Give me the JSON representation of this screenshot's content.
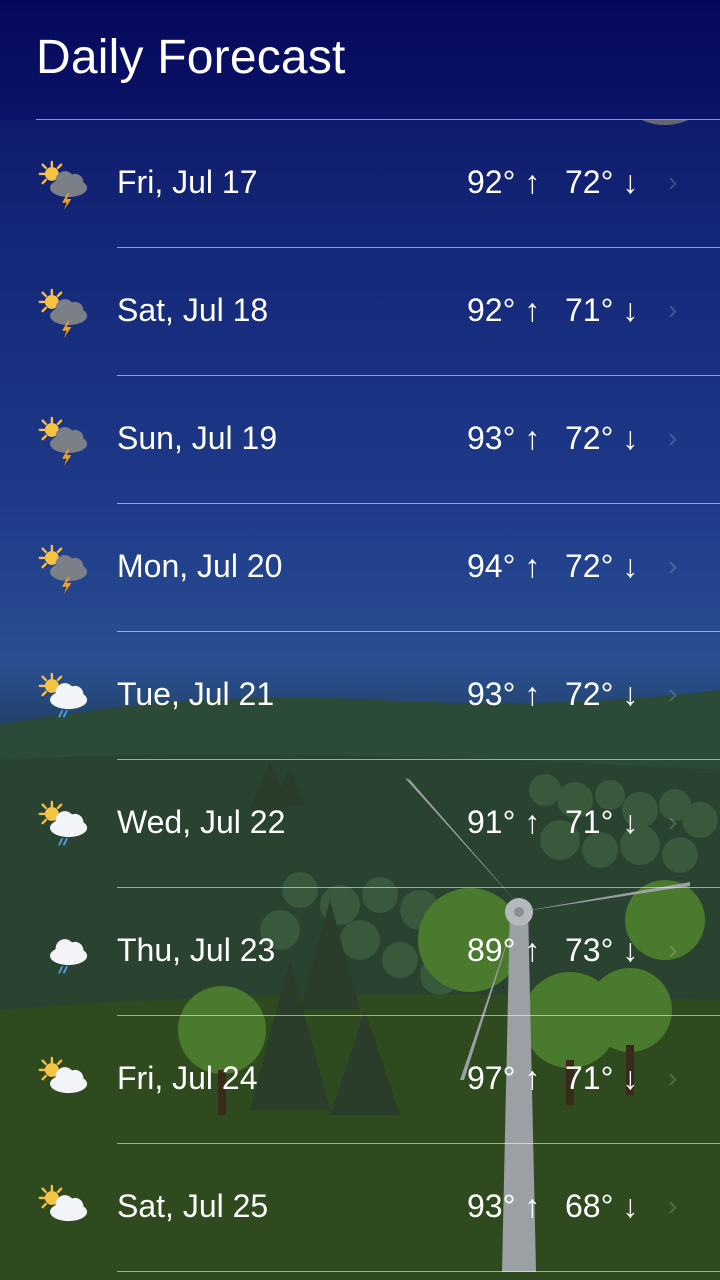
{
  "header": {
    "title": "Daily Forecast"
  },
  "days": [
    {
      "date": "Fri, Jul 17",
      "high": "92° ↑",
      "low": "72° ↓",
      "icon": "thunderstorm-icon"
    },
    {
      "date": "Sat, Jul 18",
      "high": "92° ↑",
      "low": "71° ↓",
      "icon": "thunderstorm-icon"
    },
    {
      "date": "Sun, Jul 19",
      "high": "93° ↑",
      "low": "72° ↓",
      "icon": "thunderstorm-icon"
    },
    {
      "date": "Mon, Jul 20",
      "high": "94° ↑",
      "low": "72° ↓",
      "icon": "thunderstorm-icon"
    },
    {
      "date": "Tue, Jul 21",
      "high": "93° ↑",
      "low": "72° ↓",
      "icon": "sun-rain-icon"
    },
    {
      "date": "Wed, Jul 22",
      "high": "91° ↑",
      "low": "71° ↓",
      "icon": "sun-rain-icon"
    },
    {
      "date": "Thu, Jul 23",
      "high": "89° ↑",
      "low": "73° ↓",
      "icon": "rain-icon"
    },
    {
      "date": "Fri, Jul 24",
      "high": "97° ↑",
      "low": "71° ↓",
      "icon": "partly-cloudy-icon"
    },
    {
      "date": "Sat, Jul 25",
      "high": "93° ↑",
      "low": "68° ↓",
      "icon": "partly-cloudy-icon"
    }
  ],
  "colors": {
    "sun": "#f5c242",
    "bolt": "#f0a020",
    "rain": "#4aa0e8",
    "storm_cloud": "#7a7f88",
    "light_cloud": "#f2f4f7"
  }
}
